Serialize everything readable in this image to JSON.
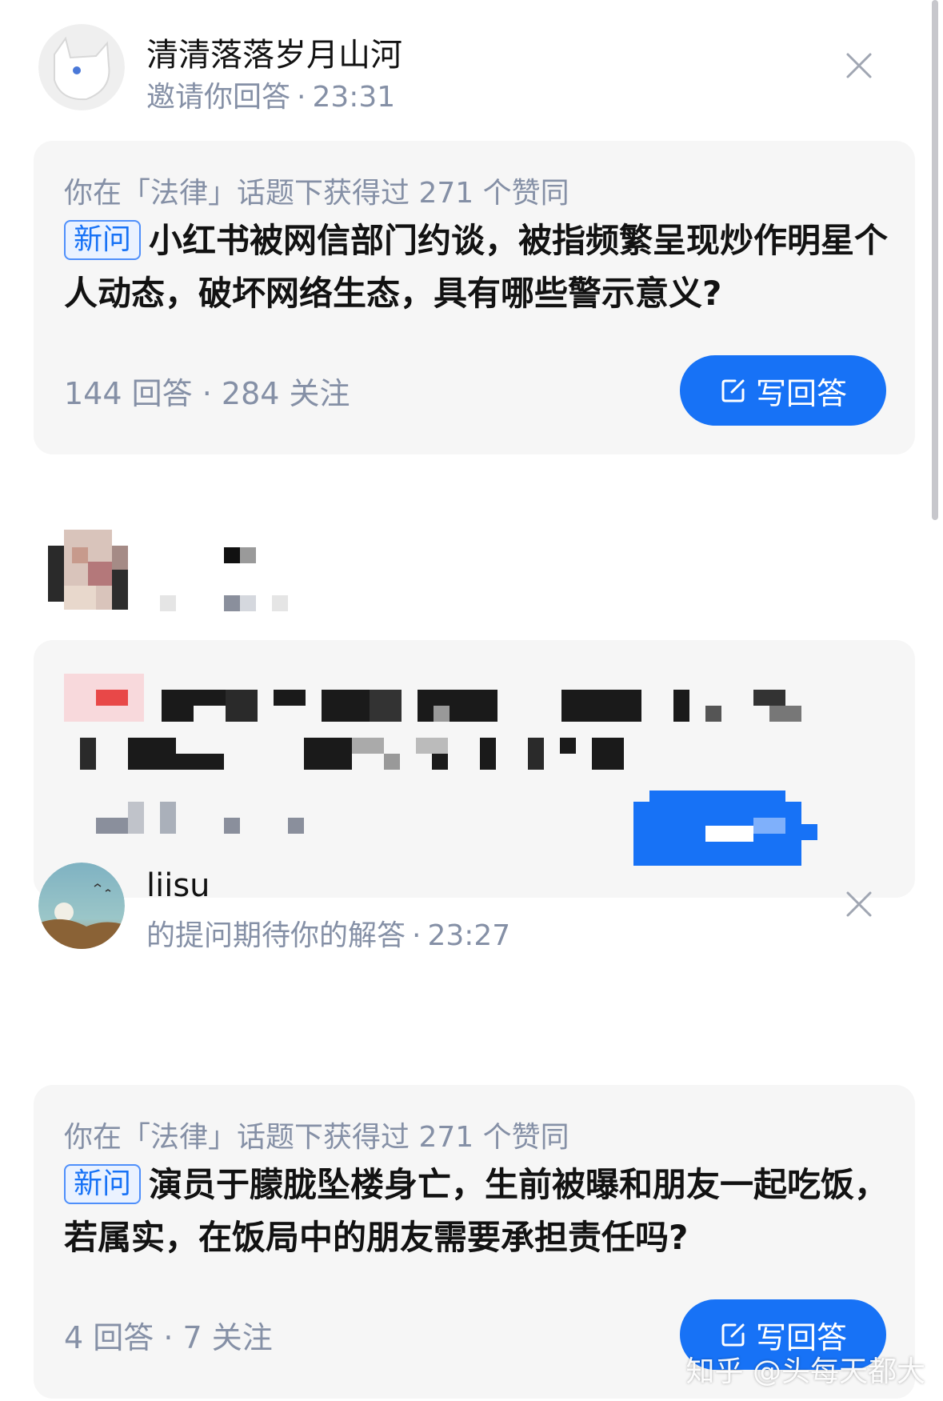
{
  "items": [
    {
      "user_name": "清清落落岁月山河",
      "action": "邀请你回答",
      "time": "23:31",
      "reason": "你在「法律」话题下获得过 271 个赞同",
      "badge": "新问",
      "question": "小红书被网信部门约谈，被指频繁呈现炒作明星个人动态，破坏网络生态，具有哪些警示意义?",
      "answers": "144 回答",
      "follows": "284 关注",
      "button": "写回答"
    },
    {
      "user_name": "liisu",
      "action": "的提问期待你的解答",
      "time": "23:27",
      "reason": "你在「法律」话题下获得过 271 个赞同",
      "badge": "新问",
      "question": "演员于朦胧坠楼身亡，生前被曝和朋友一起吃饭，若属实，在饭局中的朋友需要承担责任吗?",
      "answers": "4 回答",
      "follows": "7 关注",
      "button": "写回答"
    }
  ],
  "separator": "·",
  "watermark": "知乎 @头每天都大",
  "colors": {
    "accent": "#1772f6",
    "card_bg": "#f6f6f6",
    "muted_text": "#8590a6"
  },
  "icons": [
    "close-icon",
    "edit-icon"
  ]
}
